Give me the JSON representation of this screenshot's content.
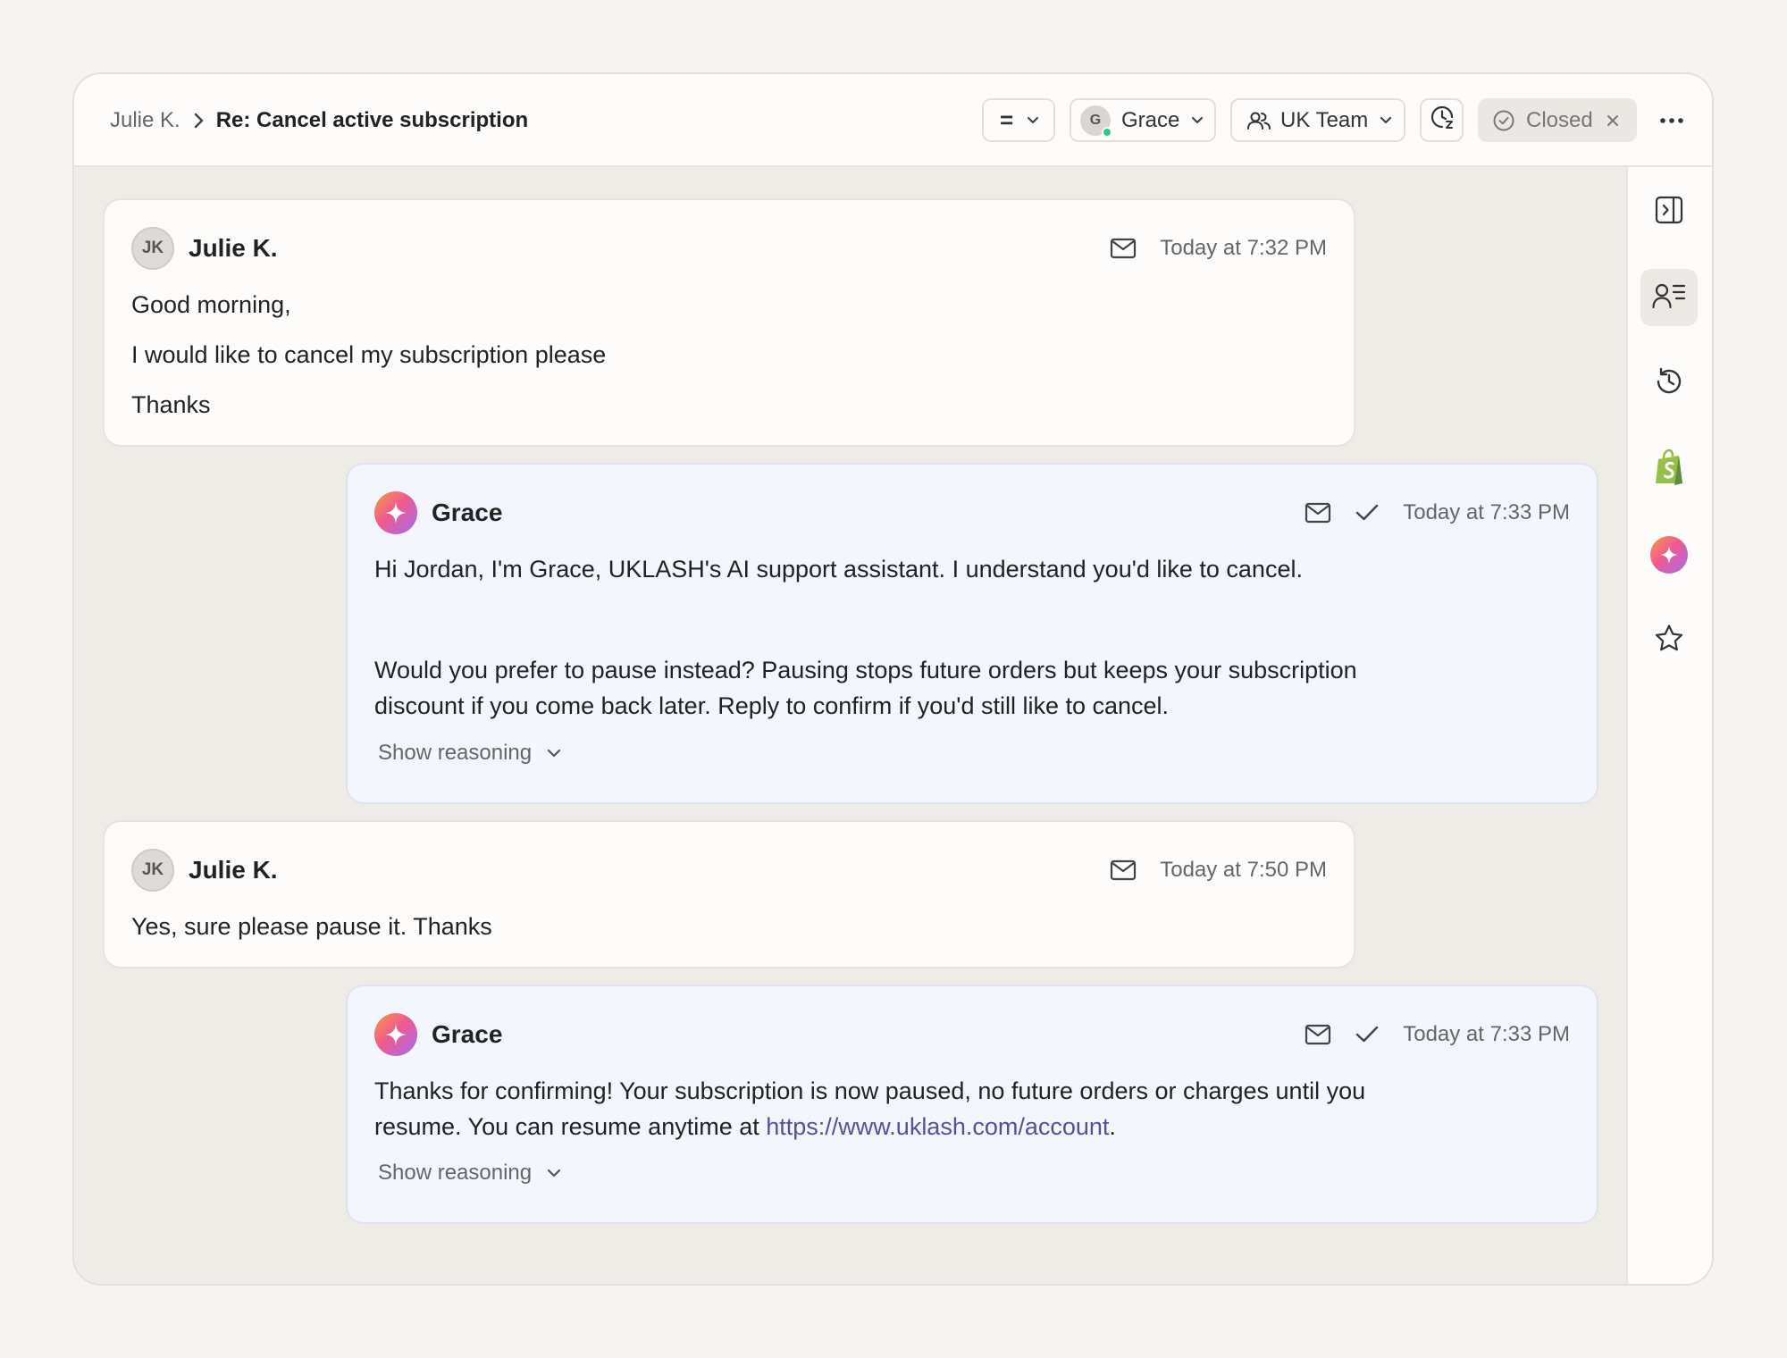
{
  "header": {
    "breadcrumb_parent": "Julie K.",
    "breadcrumb_current": "Re: Cancel active subscription",
    "priority_label": "=",
    "agent_initial": "G",
    "agent_name": "Grace",
    "team_name": "UK Team",
    "status_label": "Closed"
  },
  "messages": [
    {
      "sender": "Julie K.",
      "initials": "JK",
      "time": "Today at 7:32 PM",
      "lines": [
        "Good morning,",
        "I would like to cancel my subscription please",
        "Thanks"
      ]
    },
    {
      "sender": "Grace",
      "time": "Today at 7:33 PM",
      "lines": [
        "Hi Jordan, I'm Grace, UKLASH's AI support assistant. I understand you'd like to cancel.",
        "Would you prefer to pause instead? Pausing stops future orders but keeps your subscription",
        "discount if you come back later. Reply to confirm if you'd still like to cancel."
      ],
      "reasoning_label": "Show reasoning"
    },
    {
      "sender": "Julie K.",
      "initials": "JK",
      "time": "Today at 7:50 PM",
      "lines": [
        "Yes, sure please pause it. Thanks"
      ]
    },
    {
      "sender": "Grace",
      "time": "Today at 7:33 PM",
      "line1": "Thanks for confirming! Your subscription is now paused, no future orders or charges until you",
      "line2_prefix": "resume. You can resume anytime at ",
      "line2_link": "https://www.uklash.com/account",
      "line2_suffix": ".",
      "reasoning_label": "Show reasoning"
    }
  ],
  "icons": {
    "rail": [
      "sidebar-expand-icon",
      "customer-profile-icon",
      "history-icon",
      "shopify-icon",
      "ai-sparkle-icon",
      "star-icon"
    ],
    "message": [
      "mail-icon",
      "check-icon",
      "chevron-down-icon"
    ]
  },
  "colors": {
    "background": "#f5f4f2",
    "canvas": "#efebe6",
    "ai_bubble": "#f3f6fd",
    "link": "#5a4c9e",
    "online": "#2fc98a",
    "shopify": "#95bf47"
  }
}
